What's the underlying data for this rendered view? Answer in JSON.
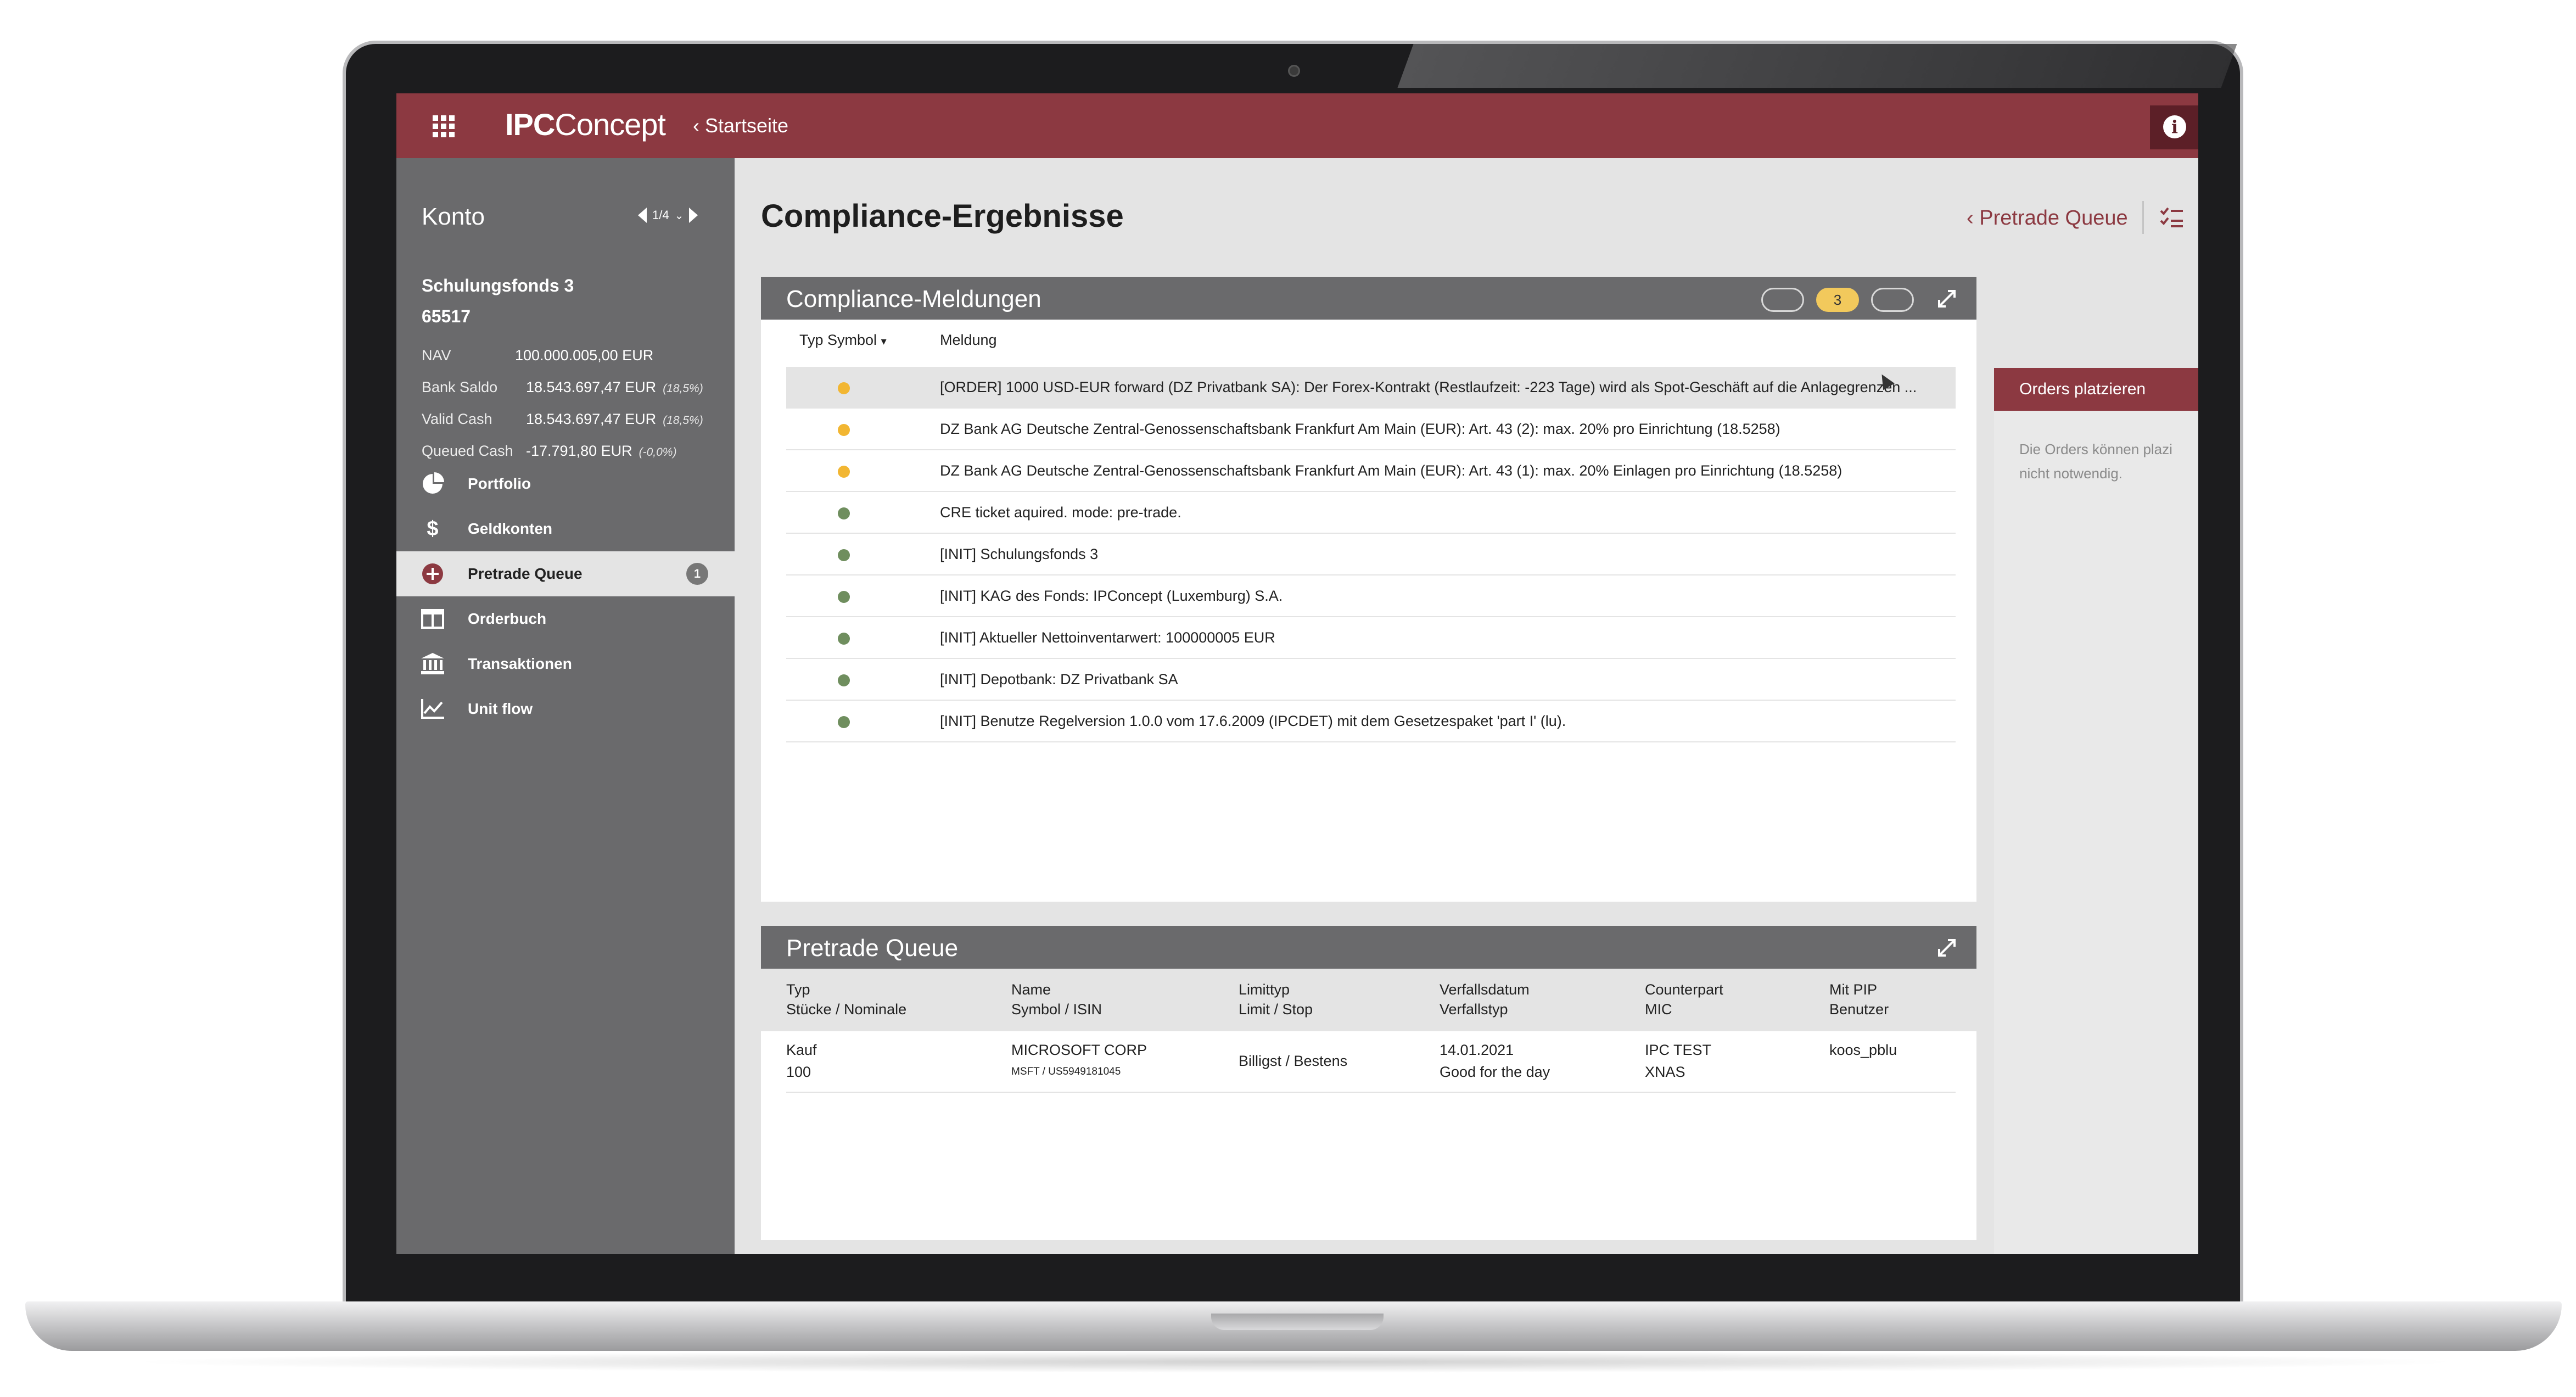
{
  "app": {
    "brand_bold": "IPC",
    "brand_rest": "oncept",
    "back_label": "Startseite"
  },
  "sidebar": {
    "konto_title": "Konto",
    "pager": "1/4",
    "fund_name": "Schulungsfonds 3",
    "fund_id": "65517",
    "kv": [
      {
        "key": "NAV",
        "value": "100.000.005,00 EUR",
        "pct": ""
      },
      {
        "key": "Bank Saldo",
        "value": "18.543.697,47 EUR",
        "pct": "(18,5%)"
      },
      {
        "key": "Valid Cash",
        "value": "18.543.697,47 EUR",
        "pct": "(18,5%)"
      },
      {
        "key": "Queued Cash",
        "value": "-17.791,80 EUR",
        "pct": "(-0,0%)"
      }
    ],
    "nav": [
      {
        "label": "Portfolio",
        "icon": "pie-chart-icon"
      },
      {
        "label": "Geldkonten",
        "icon": "dollar-icon"
      },
      {
        "label": "Pretrade Queue",
        "icon": "plus-circle-icon",
        "badge": "1",
        "active": true
      },
      {
        "label": "Orderbuch",
        "icon": "book-icon"
      },
      {
        "label": "Transaktionen",
        "icon": "bank-icon"
      },
      {
        "label": "Unit flow",
        "icon": "line-chart-icon"
      }
    ]
  },
  "main": {
    "title": "Compliance-Ergebnisse",
    "pretrade_link": "Pretrade Queue"
  },
  "compliance": {
    "title": "Compliance-Meldungen",
    "warn_count": "3",
    "col_typ": "Typ Symbol",
    "col_meldung": "Meldung",
    "rows": [
      {
        "status": "warn",
        "msg": "[ORDER] 1000 USD-EUR forward (DZ Privatbank SA): Der Forex-Kontrakt (Restlaufzeit: -223 Tage) wird als Spot-Geschäft auf die Anlagegrenzen ..."
      },
      {
        "status": "warn",
        "msg": "DZ Bank AG Deutsche Zentral-Genossenschaftsbank Frankfurt Am Main (EUR): Art. 43 (2): max. 20% pro Einrichtung (18.5258)"
      },
      {
        "status": "warn",
        "msg": "DZ Bank AG Deutsche Zentral-Genossenschaftsbank Frankfurt Am Main (EUR): Art. 43 (1): max. 20% Einlagen pro Einrichtung (18.5258)"
      },
      {
        "status": "ok",
        "msg": "CRE ticket aquired. mode: pre-trade."
      },
      {
        "status": "ok",
        "msg": "[INIT] Schulungsfonds 3"
      },
      {
        "status": "ok",
        "msg": "[INIT] KAG des Fonds: IPConcept (Luxemburg) S.A."
      },
      {
        "status": "ok",
        "msg": "[INIT] Aktueller Nettoinventarwert: 100000005 EUR"
      },
      {
        "status": "ok",
        "msg": "[INIT] Depotbank: DZ Privatbank SA"
      },
      {
        "status": "ok",
        "msg": "[INIT] Benutze Regelversion 1.0.0 vom 17.6.2009 (IPCDET) mit dem Gesetzespaket 'part I' (lu)."
      }
    ]
  },
  "pretrade": {
    "title": "Pretrade Queue",
    "headers": [
      {
        "l1": "Typ",
        "l2": "Stücke / Nominale"
      },
      {
        "l1": "Name",
        "l2": "Symbol / ISIN"
      },
      {
        "l1": "Limittyp",
        "l2": "Limit / Stop"
      },
      {
        "l1": "Verfallsdatum",
        "l2": "Verfallstyp"
      },
      {
        "l1": "Counterpart",
        "l2": "MIC"
      },
      {
        "l1": "Mit PIP",
        "l2": "Benutzer"
      }
    ],
    "row": {
      "typ": "Kauf",
      "stuecke": "100",
      "name": "MICROSOFT CORP",
      "isin": "MSFT / US5949181045",
      "limit": "Billigst / Bestens",
      "verfall": "14.01.2021",
      "verfallstyp": "Good for the day",
      "counterpart": "IPC TEST",
      "mic": "XNAS",
      "pip": "",
      "benutzer": "koos_pblu"
    }
  },
  "orders": {
    "title": "Orders platzieren",
    "text_line1": "Die Orders können plazi",
    "text_line2": "nicht notwendig."
  },
  "colors": {
    "accent": "#8c3941",
    "sidebar": "#6a6a6c",
    "warn": "#f2b632",
    "ok": "#6f8e5e"
  }
}
